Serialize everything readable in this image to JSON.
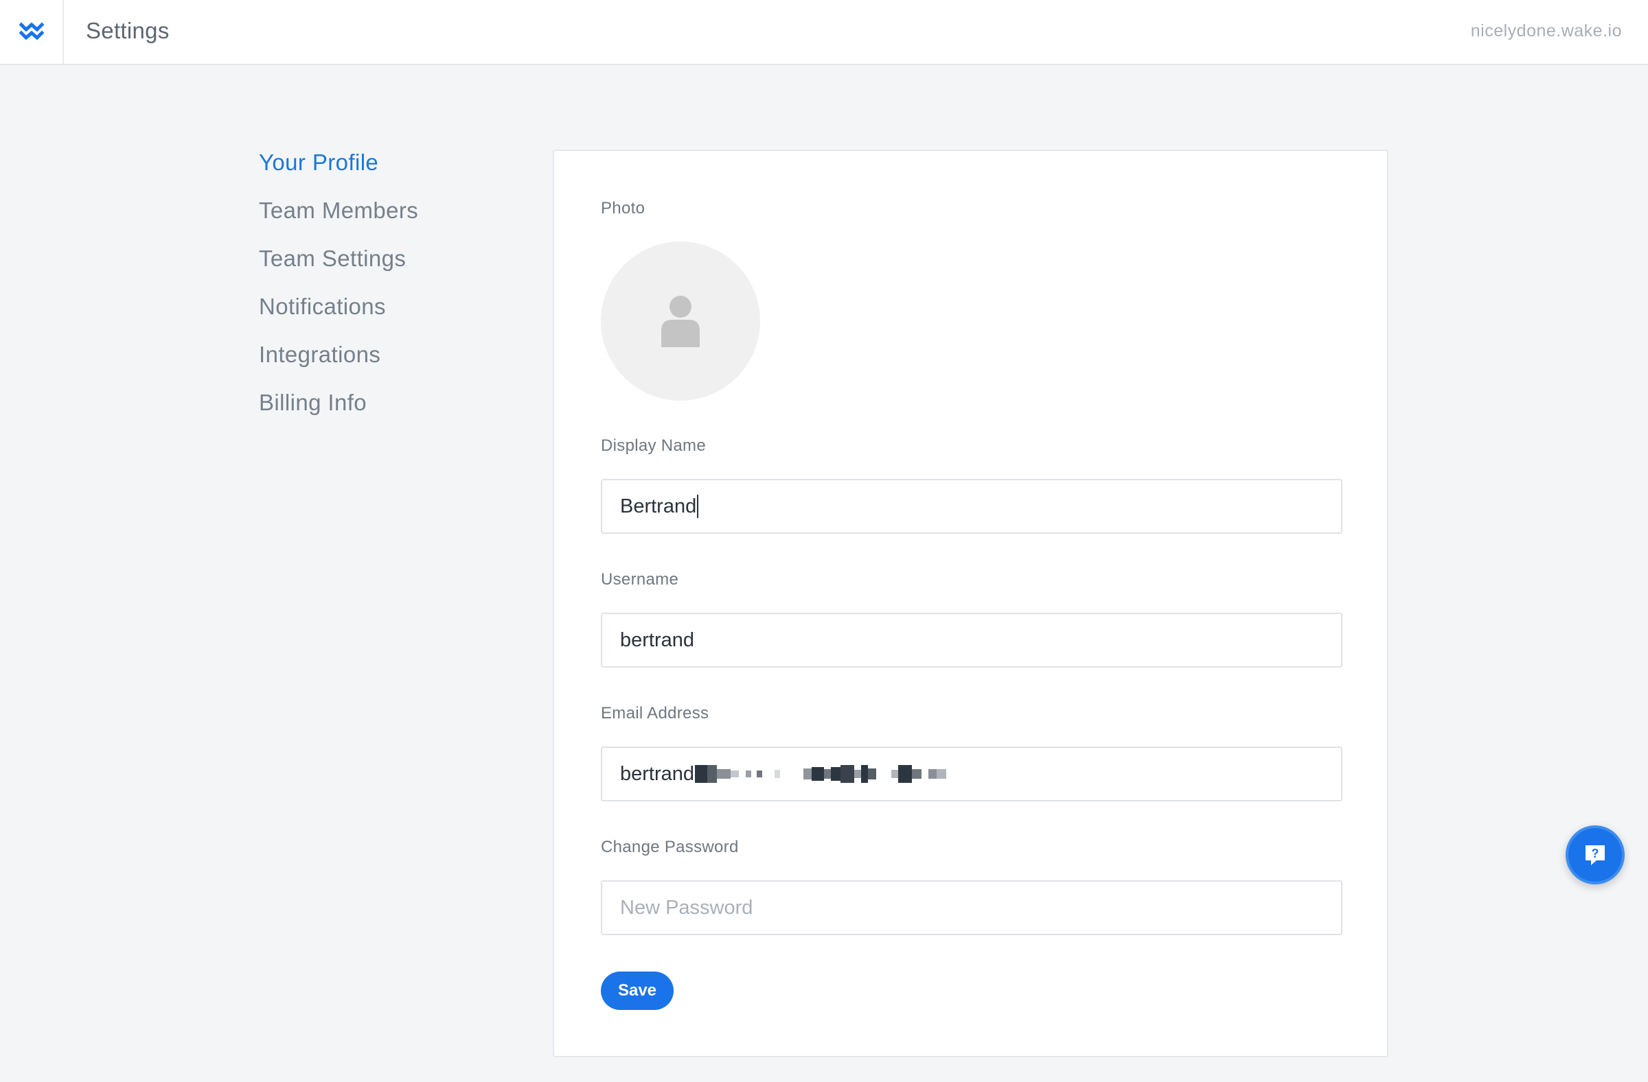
{
  "header": {
    "title": "Settings",
    "domain": "nicelydone.wake.io",
    "logo_icon": "wake-logo-icon"
  },
  "sidebar": {
    "items": [
      {
        "label": "Your Profile",
        "active": true
      },
      {
        "label": "Team Members",
        "active": false
      },
      {
        "label": "Team Settings",
        "active": false
      },
      {
        "label": "Notifications",
        "active": false
      },
      {
        "label": "Integrations",
        "active": false
      },
      {
        "label": "Billing Info",
        "active": false
      }
    ]
  },
  "profile": {
    "photo_label": "Photo",
    "display_name_label": "Display Name",
    "display_name_value": "Bertrand",
    "username_label": "Username",
    "username_value": "bertrand",
    "email_label": "Email Address",
    "email_value_visible": "bertrand",
    "password_label": "Change Password",
    "password_placeholder": "New Password",
    "save_label": "Save"
  },
  "colors": {
    "accent": "#1a73e8",
    "active_nav": "#1a78d6",
    "background": "#f4f5f7"
  }
}
